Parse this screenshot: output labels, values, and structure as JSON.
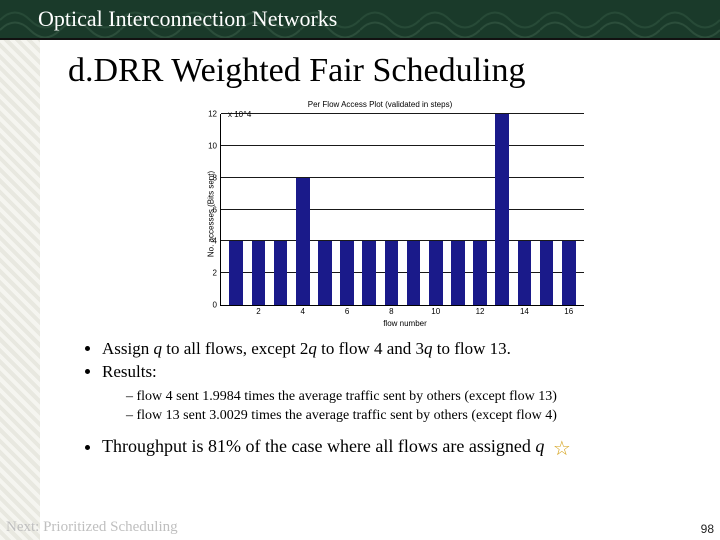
{
  "header": {
    "title": "Optical Interconnection Networks"
  },
  "slide_title": "d.DRR Weighted Fair Scheduling",
  "chart_data": {
    "type": "bar",
    "title": "Per Flow Access Plot (validated in steps)",
    "exponent": "x 10^4",
    "xlabel": "flow number",
    "ylabel": "No. accesses (Bits sent)",
    "ylim": [
      0,
      12
    ],
    "yticks": [
      0,
      2,
      4,
      6,
      8,
      10,
      12
    ],
    "xticks": [
      2,
      4,
      6,
      8,
      10,
      12,
      14,
      16
    ],
    "categories": [
      1,
      2,
      3,
      4,
      5,
      6,
      7,
      8,
      9,
      10,
      11,
      12,
      13,
      14,
      15,
      16
    ],
    "values": [
      4,
      4,
      4,
      8,
      4,
      4,
      4,
      4,
      4,
      4,
      4,
      4,
      12,
      4,
      4,
      4
    ]
  },
  "bullets": {
    "b1_1_pre": "Assign ",
    "b1_1_q1": "q",
    "b1_1_mid1": " to all flows, except 2",
    "b1_1_q2": "q",
    "b1_1_mid2": " to flow 4 and 3",
    "b1_1_q3": "q",
    "b1_1_post": " to flow 13.",
    "b1_2": "Results:",
    "b2_1": "flow 4 sent 1.9984 times the average traffic sent by others (except flow 13)",
    "b2_2": "flow 13 sent 3.0029 times the average traffic sent by others (except flow 4)",
    "b3_1_pre": "Throughput is 81% of the case where all flows are assigned ",
    "b3_1_q": "q"
  },
  "footer": {
    "next": "Next: Prioritized Scheduling"
  },
  "pagenum": "98"
}
